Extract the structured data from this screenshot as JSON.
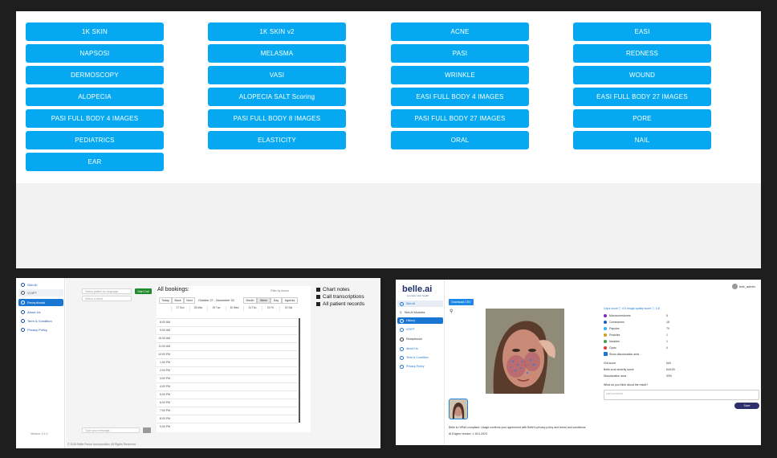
{
  "top_menu": {
    "buttons": [
      "1K SKIN",
      "1K SKIN v2",
      "ACNE",
      "EASI",
      "NAPSOSI",
      "MELASMA",
      "PASI",
      "REDNESS",
      "DERMOSCOPY",
      "VASI",
      "WRINKLE",
      "WOUND",
      "ALOPECIA",
      "ALOPECIA SALT Scoring",
      "EASI FULL BODY 4 IMAGES",
      "EASI FULL BODY 27 IMAGES",
      "PASI FULL BODY 4 IMAGES",
      "PASI FULL BODY 8 IMAGES",
      "PASI FULL BODY 27 IMAGES",
      "PORE",
      "PEDIATRICS",
      "ELASTICITY",
      "ORAL",
      "NAIL",
      "EAR"
    ],
    "button_color": "#05a8f1"
  },
  "bookings": {
    "sidebar": {
      "items": [
        "Skin AI",
        "VOIPT",
        "Receptionist",
        "About Us",
        "Term & Condition",
        "Privacy Policy"
      ],
      "version": "Version: 2.1.0"
    },
    "search_placeholder": "Select patient by language",
    "filter_placeholder": "Select a client",
    "start_call": "Start Call",
    "type_message_placeholder": "Type your message...",
    "footer": "© 2025 Belle Ponce Incorporation. All Rights Reserved.",
    "calendar": {
      "title": "All bookings:",
      "filter_label": "Filter by doctor",
      "nav": [
        "Today",
        "Back",
        "Next"
      ],
      "range": "October 27 - November 02",
      "views": [
        "Month",
        "Week",
        "Day",
        "Agenda"
      ],
      "active_view": "Week",
      "days": [
        "27 Sun",
        "28 Mon",
        "29 Tue",
        "30 Wed",
        "31 Thu",
        "01 Fri",
        "02 Sat"
      ],
      "hours": [
        "8:00 AM",
        "9:00 AM",
        "10:00 AM",
        "11:00 AM",
        "12:00 PM",
        "1:00 PM",
        "2:00 PM",
        "3:00 PM",
        "4:00 PM",
        "5:00 PM",
        "6:00 PM",
        "7:00 PM",
        "8:00 PM",
        "9:00 PM"
      ]
    },
    "notes": [
      "Chart notes",
      "Call transcriptions",
      "All patient records"
    ]
  },
  "analysis": {
    "logo": "belle.ai",
    "logo_sub": "precision skin health",
    "user": "bde_admin",
    "sidebar": [
      "Skin AI",
      "Skin AI Modules",
      "History",
      "VOIPT",
      "Receptionist",
      "About Us",
      "Term & Condition",
      "Privacy Policy"
    ],
    "download_csv": "Download CSV",
    "scores_header": "Caps scoreⓘ: 0.6     Image quality scoreⓘ: 0.8",
    "lesions": [
      {
        "name": "Microcomedones",
        "count": "5",
        "color": "#7b2cbf"
      },
      {
        "name": "Comedones",
        "count": "18",
        "color": "#1565c0"
      },
      {
        "name": "Papules",
        "count": "79",
        "color": "#29b6f6"
      },
      {
        "name": "Pustules",
        "count": "1",
        "color": "#d4a017"
      },
      {
        "name": "Nodules",
        "count": "1",
        "color": "#43a047"
      },
      {
        "name": "Cysts",
        "count": "0",
        "color": "#e53935"
      }
    ],
    "show_area": "Show discoloration area",
    "metrics": [
      {
        "label": "IGA score",
        "value": "N/A"
      },
      {
        "label": "Belle.ai ai severity score",
        "value": "64/100"
      },
      {
        "label": "Discoloration area",
        "value": "33%"
      }
    ],
    "question": "What do you think about the result?",
    "comment_placeholder": "add comment",
    "save": "Save",
    "hipaa_text": "Belle is HIPAA compliant. Usage confirms your agreement with Belle's privacy policy and terms and conditions.",
    "engine_version": "AI Engine version: 1.16.0-2024"
  }
}
